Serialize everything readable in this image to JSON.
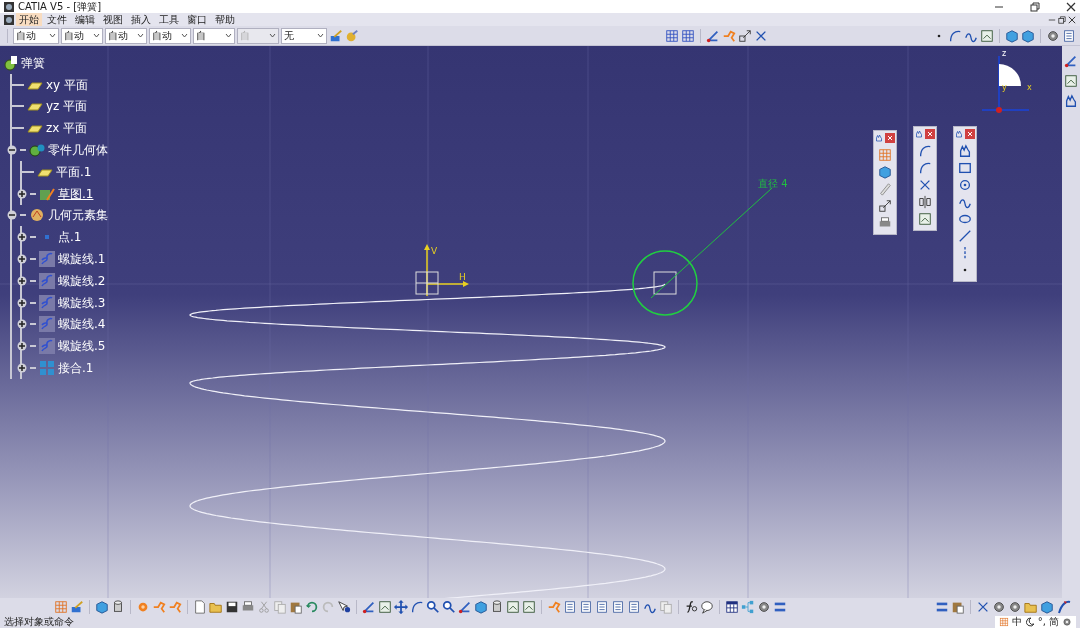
{
  "window": {
    "title": "CATIA V5 - [弹簧]"
  },
  "menu": [
    {
      "label": "开始",
      "selected": true
    },
    {
      "label": "文件",
      "selected": false
    },
    {
      "label": "编辑",
      "selected": false
    },
    {
      "label": "视图",
      "selected": false
    },
    {
      "label": "插入",
      "selected": false
    },
    {
      "label": "工具",
      "selected": false
    },
    {
      "label": "窗口",
      "selected": false
    },
    {
      "label": "帮助",
      "selected": false
    }
  ],
  "dropdowns": [
    {
      "value": "自动",
      "disabled": false
    },
    {
      "value": "自动",
      "disabled": false
    },
    {
      "value": "自动",
      "disabled": false
    },
    {
      "value": "自动",
      "disabled": false
    },
    {
      "value": "自",
      "disabled": false
    },
    {
      "value": "自",
      "disabled": true
    },
    {
      "value": "无",
      "disabled": false
    }
  ],
  "tree": {
    "label": "弹簧",
    "kind": "part",
    "underlined": false,
    "children": [
      {
        "label": "xy 平面",
        "kind": "plane",
        "underlined": false
      },
      {
        "label": "yz 平面",
        "kind": "plane",
        "underlined": false
      },
      {
        "label": "zx 平面",
        "kind": "plane",
        "underlined": false
      },
      {
        "label": "零件几何体",
        "kind": "body",
        "expanded": true,
        "underlined": false,
        "children": [
          {
            "label": "平面.1",
            "kind": "plane",
            "underlined": false
          },
          {
            "label": "草图.1",
            "kind": "sketch",
            "expanded": false,
            "underlined": true
          }
        ]
      },
      {
        "label": "几何元素集",
        "kind": "geoset",
        "expanded": true,
        "underlined": false,
        "children": [
          {
            "label": "点.1",
            "kind": "point",
            "expanded": false,
            "underlined": false
          },
          {
            "label": "螺旋线.1",
            "kind": "helix",
            "expanded": false,
            "underlined": false
          },
          {
            "label": "螺旋线.2",
            "kind": "helix",
            "expanded": false,
            "underlined": false
          },
          {
            "label": "螺旋线.3",
            "kind": "helix",
            "expanded": false,
            "underlined": false
          },
          {
            "label": "螺旋线.4",
            "kind": "helix",
            "expanded": false,
            "underlined": false
          },
          {
            "label": "螺旋线.5",
            "kind": "helix",
            "expanded": false,
            "underlined": false
          },
          {
            "label": "接合.1",
            "kind": "join",
            "expanded": false,
            "underlined": false
          }
        ]
      }
    ]
  },
  "sketch_axes": {
    "v": "V",
    "h": "H"
  },
  "dimension": {
    "label": "直径 4"
  },
  "compass": {
    "z": "z",
    "y": "y",
    "x": "x"
  },
  "status_bar": {
    "text": "选择对象或命令"
  },
  "ime": [
    "中",
    "°,",
    "简"
  ]
}
